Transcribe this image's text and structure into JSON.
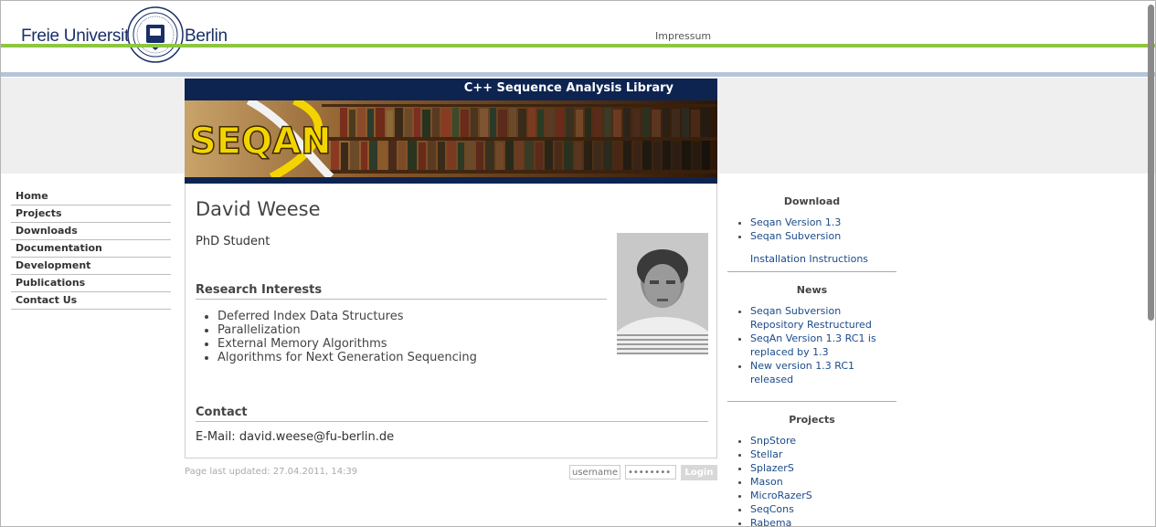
{
  "header": {
    "university_left": "Freie Universität",
    "university_right": "Berlin",
    "impressum": "Impressum"
  },
  "banner": {
    "title": "C++ Sequence Analysis Library",
    "logo_text": "SEQAN"
  },
  "nav": {
    "items": [
      "Home",
      "Projects",
      "Downloads",
      "Documentation",
      "Development",
      "Publications",
      "Contact Us"
    ]
  },
  "profile": {
    "name": "David Weese",
    "role": "PhD Student",
    "interests_heading": "Research Interests",
    "interests": [
      "Deferred Index Data Structures",
      "Parallelization",
      "External Memory Algorithms",
      "Algorithms for Next Generation Sequencing"
    ],
    "contact_heading": "Contact",
    "email_line": "E-Mail: david.weese@fu-berlin.de"
  },
  "footer": {
    "updated": "Page last updated: 27.04.2011, 14:39",
    "username_placeholder": "username",
    "password_placeholder": "••••••••",
    "login": "Login"
  },
  "sidebar": {
    "download_heading": "Download",
    "download_items": [
      "Seqan Version 1.3",
      "Seqan Subversion"
    ],
    "install_link": "Installation Instructions",
    "news_heading": "News",
    "news_items": [
      "Seqan Subversion Repository Restructured",
      "SeqAn Version 1.3 RC1 is replaced by 1.3",
      "New version 1.3 RC1 released"
    ],
    "projects_heading": "Projects",
    "projects": [
      "SnpStore",
      "Stellar",
      "SplazerS",
      "Mason",
      "MicroRazerS",
      "SeqCons",
      "Rabema"
    ]
  },
  "colors": {
    "accent_green": "#8dc63f",
    "banner_blue": "#0d2451",
    "link_blue": "#1a4a8a"
  }
}
